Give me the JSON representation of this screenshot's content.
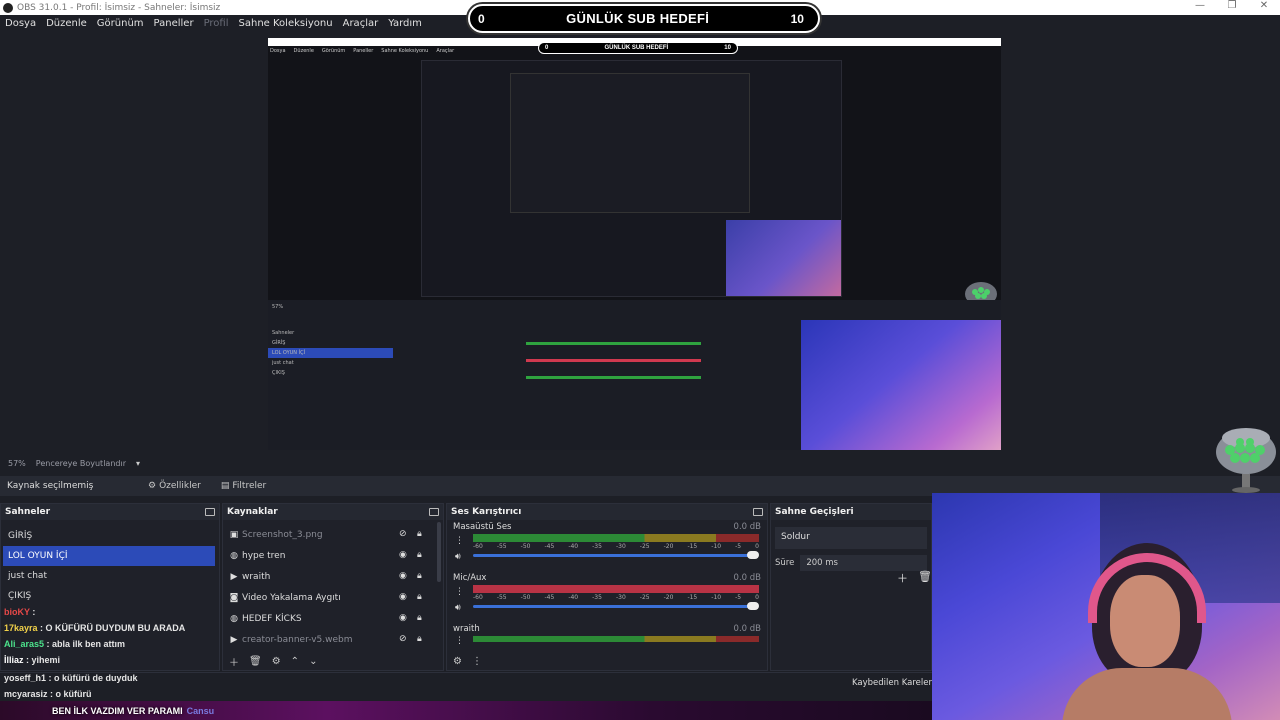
{
  "window": {
    "title": "OBS 31.0.1 - Profil: İsimsiz - Sahneler: İsimsiz",
    "controls": [
      "—",
      "❐",
      "✕"
    ]
  },
  "menu": [
    "Dosya",
    "Düzenle",
    "Görünüm",
    "Paneller",
    "Profil",
    "Sahne Koleksiyonu",
    "Araçlar",
    "Yardım"
  ],
  "sub_goal": {
    "left": "0",
    "title": "GÜNLÜK SUB HEDEFİ",
    "right": "10"
  },
  "preview": {
    "zoom": "57%",
    "fit": "Pencereye Boyutlandır",
    "mini_zoom": "57%"
  },
  "source_bar": {
    "label": "Kaynak seçilmemiş",
    "properties": "Özellikler",
    "filters": "Filtreler"
  },
  "scenes": {
    "title": "Sahneler",
    "items": [
      "GİRİŞ",
      "LOL OYUN İÇİ",
      "just chat",
      "ÇIKIŞ"
    ],
    "active_index": 1
  },
  "sources": {
    "title": "Kaynaklar",
    "items": [
      {
        "label": "Screenshot_3.png",
        "icon": "image-icon",
        "visible": false
      },
      {
        "label": "hype tren",
        "icon": "browser-icon",
        "visible": true
      },
      {
        "label": "wraith",
        "icon": "play-icon",
        "visible": true
      },
      {
        "label": "Video Yakalama Aygıtı",
        "icon": "camera-icon",
        "visible": true
      },
      {
        "label": "HEDEF KİCKS",
        "icon": "browser-icon",
        "visible": true
      },
      {
        "label": "creator-banner-v5.webm",
        "icon": "play-icon",
        "visible": false
      }
    ]
  },
  "mixer": {
    "title": "Ses Karıştırıcı",
    "ticks": [
      "-60",
      "-55",
      "-50",
      "-45",
      "-40",
      "-35",
      "-30",
      "-25",
      "-20",
      "-15",
      "-10",
      "-5",
      "0"
    ],
    "channels": [
      {
        "name": "Masaüstü Ses",
        "db": "0.0 dB",
        "muted": false
      },
      {
        "name": "Mic/Aux",
        "db": "0.0 dB",
        "muted": true
      },
      {
        "name": "wraith",
        "db": "0.0 dB",
        "muted": false
      }
    ]
  },
  "transitions": {
    "title": "Sahne Geçişleri",
    "selected": "Soldur",
    "duration_label": "Süre",
    "duration": "200 ms"
  },
  "status": {
    "dropped_frames": "Kaybedilen Kareler 0"
  },
  "chat": [
    {
      "user": "bioKY",
      "text": "",
      "user_color": "red"
    },
    {
      "user": "17kayra",
      "text": "O KÜFÜRÜ DUYDUM BU ARADA",
      "user_color": "yellow"
    },
    {
      "user": "Ali_aras5",
      "text": "abla ilk ben attım",
      "user_color": "green"
    },
    {
      "user": "İlliaz",
      "text": "yihemi",
      "user_color": "white"
    }
  ],
  "chat_lower": [
    {
      "user": "yoseff_h1",
      "text": "o küfürü de duyduk",
      "user_color": "yellow"
    },
    {
      "user": "mcyarasiz",
      "text": "o küfürü",
      "user_color": "white"
    }
  ],
  "banner": {
    "text": "BEN İLK VAZDIM VER PARAMI",
    "name": "Cansu"
  },
  "colors": {
    "accent": "#2c4bb8",
    "background": "#1d1f26",
    "meter_green": "#2c8a36",
    "meter_red": "#b83345"
  }
}
